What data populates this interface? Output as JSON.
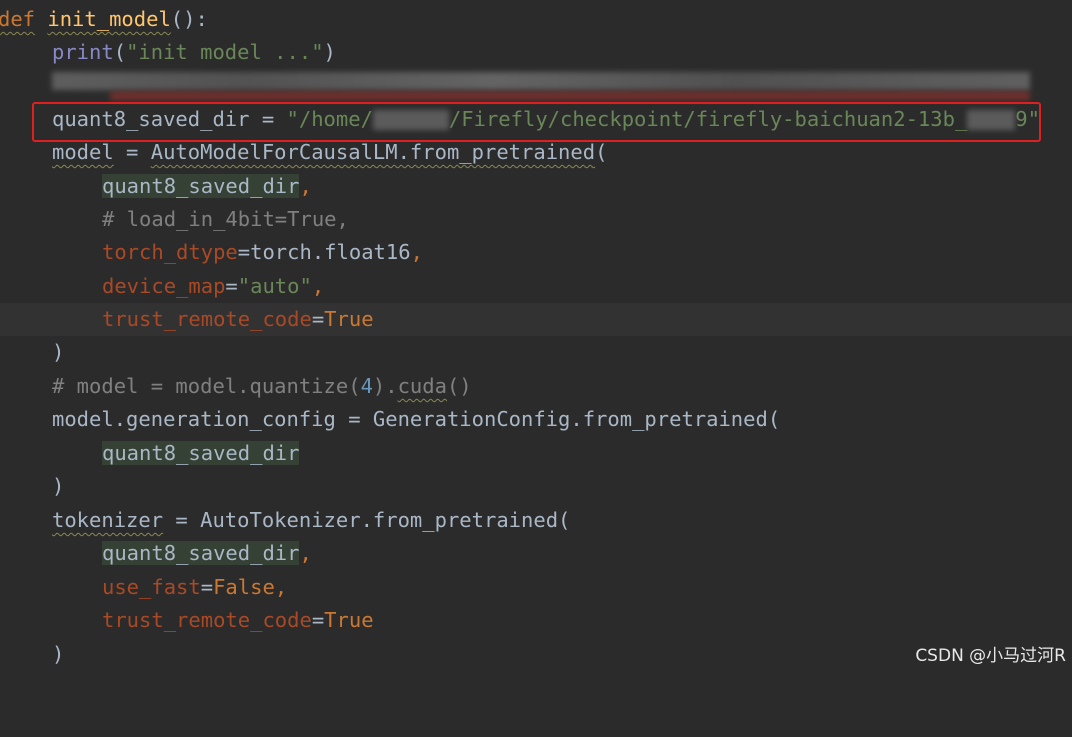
{
  "editor": {
    "colors": {
      "background": "#2b2b2b",
      "keyword": "#cc7832",
      "function": "#ffc66d",
      "string": "#6a8759",
      "parameter": "#aa4926",
      "comment": "#808080",
      "number": "#6897bb",
      "highlight_box": "#e02020"
    },
    "lines": {
      "l1": {
        "kw": "def",
        "rest": " ",
        "fname": "init_model",
        "tail": "():"
      },
      "l2": {
        "builtin": "print",
        "open": "(",
        "str": "\"init model ...\"",
        "close": ")"
      },
      "l4": {
        "var": "quant8_saved_dir",
        "op": " = ",
        "str_a": "\"/home/",
        "str_b": "/Firefly/checkpoint/firefly-baichuan2-13b_",
        "str_c": "9\""
      },
      "l5": {
        "var": "model",
        "op": " = ",
        "call": "AutoModelForCausalLM.from_pretrained",
        "open": "("
      },
      "l6": {
        "arg": "quant8_saved_dir",
        "comma": ","
      },
      "l7": {
        "comment": "# load_in_4bit=True,"
      },
      "l8": {
        "param": "torch_dtype",
        "eq": "=",
        "val": "torch.float16",
        "comma": ","
      },
      "l9": {
        "param": "device_map",
        "eq": "=",
        "str": "\"auto\"",
        "comma": ","
      },
      "l10": {
        "param": "trust_remote_code",
        "eq": "=",
        "kw": "True"
      },
      "l11": {
        "text": ")"
      },
      "l12": {
        "c1": "# model = model.quantize(",
        "num": "4",
        "c2": ").",
        "c3": "cuda",
        "c4": "()"
      },
      "l13": {
        "text": "model.generation_config = GenerationConfig.from_pretrained("
      },
      "l14": {
        "arg": "quant8_saved_dir"
      },
      "l15": {
        "text": ")"
      },
      "l16": {
        "var": "tokenizer",
        "rest": " = AutoTokenizer.from_pretrained("
      },
      "l17": {
        "arg": "quant8_saved_dir",
        "comma": ","
      },
      "l18": {
        "param": "use_fast",
        "eq": "=",
        "kw": "False",
        "comma": ","
      },
      "l19": {
        "param": "trust_remote_code",
        "eq": "=",
        "kw": "True"
      },
      "l20": {
        "text": ")"
      }
    }
  },
  "watermark": "CSDN @小马过河R"
}
